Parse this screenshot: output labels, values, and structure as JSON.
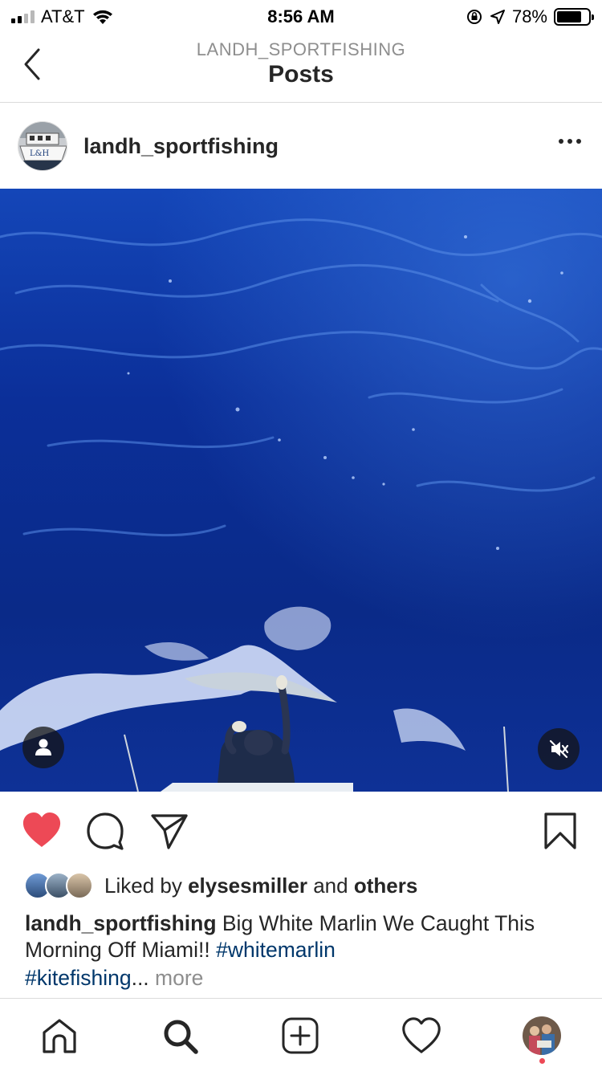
{
  "status_bar": {
    "carrier": "AT&T",
    "time": "8:56 AM",
    "battery": "78%",
    "battery_level": 0.78
  },
  "nav": {
    "subtitle": "LANDH_SPORTFISHING",
    "title": "Posts"
  },
  "post": {
    "username": "landh_sportfishing",
    "avatar_text": "L&H",
    "liked": true
  },
  "likes": {
    "prefix": "Liked by",
    "user": "elysesmiller",
    "conjunction": "and",
    "others": "others"
  },
  "caption": {
    "username": "landh_sportfishing",
    "text": "Big White Marlin We Caught This Morning Off Miami!!",
    "hashtag1": "#whitemarlin",
    "hashtag2": "#kitefishing",
    "ellipsis": "...",
    "more": "more"
  },
  "icons": {
    "back": "chevron-left-icon",
    "more": "more-horizontal-icon",
    "tag": "user-tag-icon",
    "mute": "speaker-muted-icon",
    "like": "heart-filled-icon",
    "comment": "comment-icon",
    "share": "paper-plane-icon",
    "save": "bookmark-icon",
    "home": "home-icon",
    "search": "search-icon",
    "new_post": "plus-square-icon",
    "activity": "heart-outline-icon"
  },
  "colors": {
    "like_red": "#ed4956",
    "hashtag_blue": "#00376b",
    "muted_gray": "#8e8e8e",
    "ocean_blue": "#0a2a8a"
  }
}
